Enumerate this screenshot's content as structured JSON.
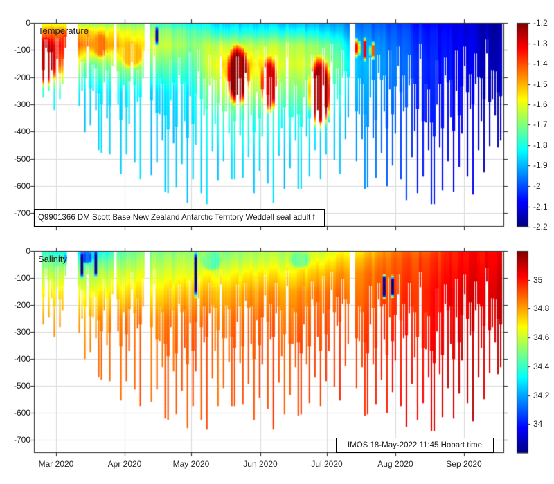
{
  "figure": {
    "background": "#ffffff",
    "text_color": "#262626",
    "grid_color": "#d9d9d9",
    "axis_color": "#262626"
  },
  "panels": {
    "temperature": {
      "title": "Temperature",
      "annotation": "Q9901366 DM Scott Base New Zealand Antarctic Territory Weddell seal adult f"
    },
    "salinity": {
      "title": "Salinity",
      "annotation": "IMOS 18-May-2022 11:45 Hobart time"
    }
  },
  "dives": {
    "spacing_days": 1.25,
    "start_day_date": "2020-02-20",
    "envelope_day_maxdepth_m": [
      [
        0,
        200
      ],
      [
        5,
        300
      ],
      [
        12,
        330
      ],
      [
        20,
        400
      ],
      [
        30,
        470
      ],
      [
        40,
        560
      ],
      [
        50,
        575
      ],
      [
        60,
        620
      ],
      [
        70,
        660
      ],
      [
        75,
        700
      ],
      [
        82,
        610
      ],
      [
        90,
        570
      ],
      [
        100,
        630
      ],
      [
        108,
        660
      ],
      [
        118,
        615
      ],
      [
        128,
        575
      ],
      [
        138,
        550
      ],
      [
        148,
        610
      ],
      [
        158,
        590
      ],
      [
        168,
        650
      ],
      [
        180,
        665
      ],
      [
        190,
        615
      ],
      [
        200,
        630
      ],
      [
        206,
        520
      ],
      [
        212,
        400
      ]
    ],
    "jitter_pattern": [
      1.0,
      0.45,
      0.7,
      0.95,
      0.3,
      0.8,
      0.55,
      1.0,
      0.4,
      0.85,
      0.65,
      0.25,
      0.9,
      0.5,
      1.0,
      0.35,
      0.75,
      0.6,
      0.95,
      0.2,
      0.85,
      0.55,
      0.7,
      1.0
    ],
    "gaps_days": [
      [
        0,
        4
      ],
      [
        14.7,
        19.3
      ],
      [
        35.5,
        37.3
      ],
      [
        50.2,
        51.8
      ],
      [
        142.2,
        144.4
      ]
    ]
  },
  "chart_data": [
    {
      "type": "heatmap",
      "title": "Temperature",
      "colormap": "jet",
      "x_axis": {
        "range_days": [
          0,
          212
        ],
        "tick_days": [
          10,
          41,
          71,
          102,
          132,
          163,
          194
        ],
        "tick_labels": [
          "Mar 2020",
          "Apr 2020",
          "May 2020",
          "Jun 2020",
          "Jul 2020",
          "Aug 2020",
          "Sep 2020"
        ],
        "labels_shown": false
      },
      "y_axis": {
        "range_m": [
          0,
          750
        ],
        "tick_m": [
          0,
          100,
          200,
          300,
          400,
          500,
          600,
          700
        ],
        "tick_labels": [
          "0",
          "-100",
          "-200",
          "-300",
          "-400",
          "-500",
          "-600",
          "-700"
        ]
      },
      "colorbar": {
        "vmin": -2.2,
        "vmax": -1.2,
        "ticks": [
          -1.2,
          -1.3,
          -1.4,
          -1.5,
          -1.6,
          -1.7,
          -1.8,
          -1.9,
          -2,
          -2.1,
          -2.2
        ],
        "tick_labels": [
          "-1.2",
          "-1.3",
          "-1.4",
          "-1.5",
          "-1.6",
          "-1.7",
          "-1.8",
          "-1.9",
          "-2",
          "-2.1",
          "-2.2"
        ]
      },
      "noise_amp": 0.06,
      "field": {
        "times_days": [
          0,
          10,
          25,
          41,
          55,
          71,
          85,
          102,
          117,
          132,
          147,
          163,
          178,
          194,
          212
        ],
        "depths_m": [
          0,
          30,
          80,
          150,
          250,
          350,
          500,
          700
        ],
        "values": [
          [
            -1.62,
            -1.48,
            -1.33,
            -1.42,
            -1.78,
            -1.85,
            -1.86,
            -1.86
          ],
          [
            -1.6,
            -1.45,
            -1.32,
            -1.38,
            -1.8,
            -1.86,
            -1.86,
            -1.86
          ],
          [
            -1.66,
            -1.52,
            -1.45,
            -1.72,
            -1.85,
            -1.87,
            -1.87,
            -1.87
          ],
          [
            -1.7,
            -1.6,
            -1.52,
            -1.66,
            -1.85,
            -1.87,
            -1.87,
            -1.87
          ],
          [
            -1.74,
            -1.66,
            -1.6,
            -1.7,
            -1.85,
            -1.87,
            -1.88,
            -1.88
          ],
          [
            -1.83,
            -1.75,
            -1.7,
            -1.77,
            -1.85,
            -1.87,
            -1.88,
            -1.88
          ],
          [
            -1.86,
            -1.8,
            -1.62,
            -1.52,
            -1.62,
            -1.76,
            -1.86,
            -1.87
          ],
          [
            -1.88,
            -1.82,
            -1.66,
            -1.56,
            -1.66,
            -1.8,
            -1.87,
            -1.88
          ],
          [
            -1.88,
            -1.8,
            -1.64,
            -1.6,
            -1.7,
            -1.8,
            -1.87,
            -1.88
          ],
          [
            -1.92,
            -1.86,
            -1.72,
            -1.66,
            -1.76,
            -1.85,
            -1.88,
            -1.88
          ],
          [
            -1.96,
            -1.94,
            -1.9,
            -1.88,
            -1.9,
            -1.92,
            -1.93,
            -1.93
          ],
          [
            -2.02,
            -2.0,
            -1.98,
            -1.97,
            -1.98,
            -2.0,
            -2.0,
            -2.0
          ],
          [
            -2.07,
            -2.05,
            -2.04,
            -2.03,
            -2.04,
            -2.05,
            -2.05,
            -2.05
          ],
          [
            -2.12,
            -2.11,
            -2.1,
            -2.1,
            -2.1,
            -2.1,
            -2.1,
            -2.1
          ],
          [
            -2.18,
            -2.17,
            -2.16,
            -2.15,
            -2.15,
            -2.15,
            -2.15,
            -2.15
          ]
        ]
      },
      "events": [
        {
          "t": 5,
          "d": 140,
          "rt": 6,
          "rd": 95,
          "v": -1.27
        },
        {
          "t": 16,
          "d": 70,
          "rt": 4,
          "rd": 55,
          "v": -1.38
        },
        {
          "t": 30,
          "d": 80,
          "rt": 4,
          "rd": 50,
          "v": -1.45
        },
        {
          "t": 44,
          "d": 115,
          "rt": 6,
          "rd": 55,
          "v": -1.52
        },
        {
          "t": 92,
          "d": 190,
          "rt": 5.5,
          "rd": 120,
          "v": -1.22
        },
        {
          "t": 106,
          "d": 225,
          "rt": 4,
          "rd": 110,
          "v": -1.3
        },
        {
          "t": 129,
          "d": 255,
          "rt": 5.5,
          "rd": 145,
          "v": -1.25
        },
        {
          "t": 146,
          "d": 90,
          "rt": 0.9,
          "rd": 48,
          "v": -1.32
        },
        {
          "t": 149.5,
          "d": 95,
          "rt": 0.9,
          "rd": 48,
          "v": -1.32
        },
        {
          "t": 152.5,
          "d": 100,
          "rt": 0.9,
          "rd": 42,
          "v": -1.38
        },
        {
          "t": 55,
          "d": 45,
          "rt": 0.8,
          "rd": 48,
          "v": -2.15
        }
      ]
    },
    {
      "type": "heatmap",
      "title": "Salinity",
      "colormap": "jet",
      "x_axis": {
        "range_days": [
          0,
          212
        ],
        "tick_days": [
          10,
          41,
          71,
          102,
          132,
          163,
          194
        ],
        "tick_labels": [
          "Mar 2020",
          "Apr 2020",
          "May 2020",
          "Jun 2020",
          "Jul 2020",
          "Aug 2020",
          "Sep 2020"
        ],
        "labels_shown": true
      },
      "y_axis": {
        "range_m": [
          0,
          750
        ],
        "tick_m": [
          0,
          100,
          200,
          300,
          400,
          500,
          600,
          700
        ],
        "tick_labels": [
          "0",
          "-100",
          "-200",
          "-300",
          "-400",
          "-500",
          "-600",
          "-700"
        ]
      },
      "colorbar": {
        "vmin": 33.8,
        "vmax": 35.2,
        "ticks": [
          35,
          34.8,
          34.6,
          34.4,
          34.2,
          34
        ],
        "tick_labels": [
          "35",
          "34.8",
          "34.6",
          "34.4",
          "34.2",
          "34"
        ]
      },
      "noise_amp": 0.08,
      "field": {
        "times_days": [
          0,
          10,
          25,
          41,
          55,
          71,
          85,
          102,
          117,
          132,
          147,
          163,
          178,
          194,
          212
        ],
        "depths_m": [
          0,
          30,
          80,
          150,
          250,
          350,
          500,
          700
        ],
        "values": [
          [
            34.4,
            34.46,
            34.56,
            34.66,
            34.8,
            34.85,
            34.86,
            34.86
          ],
          [
            34.34,
            34.44,
            34.56,
            34.68,
            34.8,
            34.86,
            34.86,
            34.86
          ],
          [
            34.26,
            34.4,
            34.55,
            34.68,
            34.82,
            34.87,
            34.87,
            34.87
          ],
          [
            34.45,
            34.5,
            34.6,
            34.7,
            34.85,
            34.88,
            34.88,
            34.88
          ],
          [
            34.5,
            34.55,
            34.62,
            34.72,
            34.85,
            34.88,
            34.9,
            34.9
          ],
          [
            34.52,
            34.56,
            34.63,
            34.75,
            34.87,
            34.9,
            34.9,
            34.9
          ],
          [
            34.5,
            34.55,
            34.66,
            34.78,
            34.87,
            34.9,
            34.9,
            34.9
          ],
          [
            34.55,
            34.58,
            34.68,
            34.8,
            34.88,
            34.9,
            34.92,
            34.92
          ],
          [
            34.56,
            34.6,
            34.7,
            34.82,
            34.88,
            34.92,
            34.92,
            34.92
          ],
          [
            34.6,
            34.66,
            34.76,
            34.85,
            34.9,
            34.92,
            34.95,
            34.95
          ],
          [
            34.72,
            34.78,
            34.85,
            34.88,
            34.92,
            34.95,
            34.95,
            34.95
          ],
          [
            34.85,
            34.88,
            34.9,
            34.92,
            34.95,
            34.97,
            35.0,
            35.0
          ],
          [
            34.92,
            34.95,
            34.97,
            35.0,
            35.0,
            35.02,
            35.05,
            35.05
          ],
          [
            35.0,
            35.0,
            35.02,
            35.05,
            35.05,
            35.08,
            35.1,
            35.1
          ],
          [
            35.05,
            35.06,
            35.08,
            35.1,
            35.1,
            35.1,
            35.1,
            35.1
          ]
        ]
      },
      "events": [
        {
          "t": 17,
          "d": 25,
          "rt": 3.5,
          "rd": 30,
          "v": 34.05
        },
        {
          "t": 24,
          "d": 22,
          "rt": 3,
          "rd": 26,
          "v": 34.1
        },
        {
          "t": 22,
          "d": 50,
          "rt": 0.7,
          "rd": 55,
          "v": 33.82
        },
        {
          "t": 28,
          "d": 45,
          "rt": 0.7,
          "rd": 50,
          "v": 33.85
        },
        {
          "t": 73,
          "d": 85,
          "rt": 0.7,
          "rd": 90,
          "v": 33.8
        },
        {
          "t": 80,
          "d": 35,
          "rt": 5,
          "rd": 40,
          "v": 34.45
        },
        {
          "t": 120,
          "d": 30,
          "rt": 5,
          "rd": 35,
          "v": 34.48
        },
        {
          "t": 158,
          "d": 130,
          "rt": 0.7,
          "rd": 48,
          "v": 33.8
        },
        {
          "t": 162,
          "d": 130,
          "rt": 0.7,
          "rd": 48,
          "v": 33.8
        }
      ]
    }
  ]
}
